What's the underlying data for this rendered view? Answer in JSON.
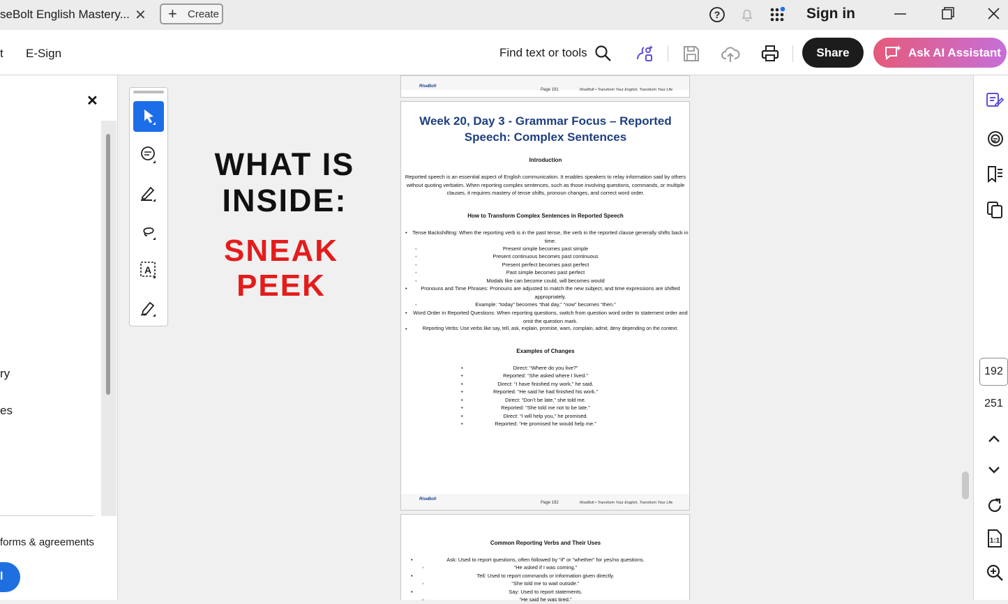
{
  "tab": {
    "title": "seBolt English Mastery...",
    "create_label": "Create"
  },
  "header": {
    "sign_in": "Sign in"
  },
  "toolbar": {
    "menu_partial": "t",
    "esign": "E-Sign",
    "find": "Find text or tools",
    "share": "Share",
    "ai_assistant": "Ask AI Assistant"
  },
  "left_panel": {
    "item_ry": "ry",
    "item_es": "es",
    "forms": "forms & agreements",
    "button_partial": "l"
  },
  "promo": {
    "line1": "WHAT IS",
    "line2": "INSIDE:",
    "line3": "SNEAK PEEK"
  },
  "page191": {
    "logo": "RiseBolt",
    "page": "Page 191",
    "tagline": "RiseBolt • Transform Your English, Transform Your Life"
  },
  "page192": {
    "title": "Week 20, Day 3 - Grammar Focus – Reported Speech: Complex Sentences",
    "intro_heading": "Introduction",
    "intro_body": "Reported speech is an essential aspect of English communication. It enables speakers to relay information said by others without quoting verbatim. When reporting complex sentences, such as those involving questions, commands, or multiple clauses, it requires mastery of tense shifts, pronoun changes, and correct word order.",
    "how_heading": "How to Transform Complex Sentences in Reported Speech",
    "bullet1": "Tense Backshifting: When the reporting verb is in the past tense, the verb in the reported clause generally shifts back in time.",
    "sub1": [
      "Present simple becomes past simple",
      "Present continuous becomes past continuous",
      "Present perfect becomes past perfect",
      "Past simple becomes past perfect",
      "Modals like can become could, will becomes would"
    ],
    "bullet2": "Pronouns and Time Phrases: Pronouns are adjusted to match the new subject, and time expressions are shifted appropriately.",
    "sub2": "Example: “today” becomes “that day,” “now” becomes “then.”",
    "bullet3": "Word Order in Reported Questions: When reporting questions, switch from question word order to statement order and omit the question mark.",
    "bullet4": "Reporting Verbs: Use verbs like say, tell, ask, explain, promise, warn, complain, admit, deny depending on the context.",
    "examples_heading": "Examples of Changes",
    "examples": [
      "Direct: “Where do you live?”",
      "Reported: “She asked where I lived.”",
      "Direct: “I have finished my work,” he said.",
      "Reported: “He said he had finished his work.”",
      "Direct: “Don’t be late,” she told me.",
      "Reported: “She told me not to be late.”",
      "Direct: “I will help you,” he promised.",
      "Reported: “He promised he would help me.”"
    ],
    "logo": "RiseBolt",
    "page": "Page 192",
    "tagline": "RiseBolt • Transform Your English, Transform Your Life"
  },
  "page193": {
    "heading": "Common Reporting Verbs and Their Uses",
    "lines": [
      "Ask: Used to report questions, often followed by “if” or “whether” for yes/no questions.",
      "“He asked if I was coming.”",
      "Tell: Used to report commands or information given directly.",
      "“She told me to wait outside.”",
      "Say: Used to report statements.",
      "“He said he was tired.”"
    ]
  },
  "right_rail": {
    "current_page": "192",
    "total_pages": "251"
  },
  "colors": {
    "accent_blue": "#1b6ee8",
    "title_blue": "#1f3f80",
    "promo_red": "#e31c1c",
    "share_bg": "#1c1c1c"
  }
}
